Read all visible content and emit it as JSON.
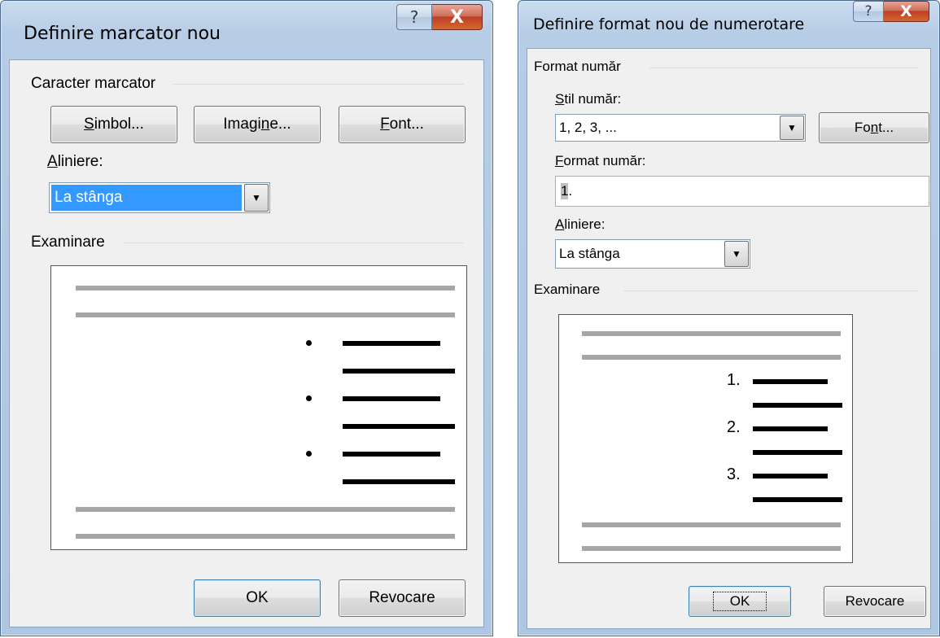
{
  "left_dialog": {
    "title": "Definire marcator nou",
    "help_glyph": "?",
    "close_glyph": "X",
    "group_character": "Caracter marcator",
    "buttons": {
      "symbol": {
        "pre": "",
        "key": "S",
        "post": "imbol..."
      },
      "image": {
        "pre": "Imagi",
        "key": "n",
        "post": "e..."
      },
      "font": {
        "pre": "",
        "key": "F",
        "post": "ont..."
      }
    },
    "align_label": {
      "pre": "",
      "key": "A",
      "post": "liniere:"
    },
    "align_value": "La stânga",
    "group_preview": "Examinare",
    "ok_label": "OK",
    "cancel_label": "Revocare"
  },
  "right_dialog": {
    "title": "Definire format nou de numerotare",
    "help_glyph": "?",
    "close_glyph": "X",
    "group_number_format": "Format număr",
    "style_label": {
      "pre": "",
      "key": "S",
      "post": "til număr:"
    },
    "style_value": "1, 2, 3, ...",
    "font_button": {
      "pre": "Fo",
      "key": "n",
      "post": "t..."
    },
    "format_label": {
      "pre": "",
      "key": "F",
      "post": "ormat număr:"
    },
    "format_value_highlight": "1",
    "format_value_rest": ".",
    "align_label": {
      "pre": "",
      "key": "A",
      "post": "liniere:"
    },
    "align_value": "La stânga",
    "group_preview": "Examinare",
    "preview_numbers": [
      "1.",
      "2.",
      "3."
    ],
    "ok_label": "OK",
    "cancel_label": "Revocare"
  },
  "colors": {
    "title_bar": "#b7cde6",
    "client": "#f0f0f0",
    "selection": "#3399ff",
    "close_button": "#c94a2e"
  }
}
